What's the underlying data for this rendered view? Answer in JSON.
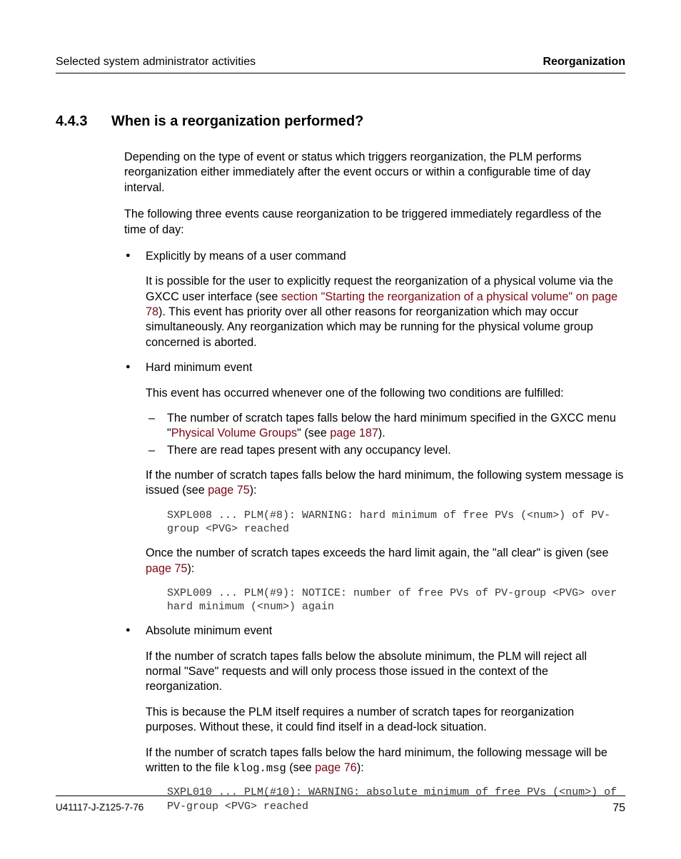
{
  "header": {
    "left": "Selected system administrator activities",
    "right": "Reorganization"
  },
  "section": {
    "number": "4.4.3",
    "title": "When is a reorganization performed?"
  },
  "intro": {
    "p1": "Depending on the type of event or status which triggers reorganization, the PLM performs reorganization either immediately after the event occurs or within a configurable time of day interval.",
    "p2": "The following three events cause reorganization to be triggered immediately regardless of the time of day:"
  },
  "b1": {
    "title": "Explicitly by means of a user command",
    "body_pre": "It is possible for the user to explicitly request the reorganization of a physical volume via the GXCC user interface (see ",
    "link": "section \"Starting the reorganization of a physical volume\" on page 78",
    "body_post": "). This event has priority over all other reasons for reorganization which may occur simultaneously. Any reorganization which may be running for the physical volume group concerned is aborted."
  },
  "b2": {
    "title": "Hard minimum event",
    "lead": "This event has occurred whenever one of the following two conditions are fulfilled:",
    "d1_pre": "The number of scratch tapes falls below the hard minimum specified in the GXCC menu \"",
    "d1_link": "Physical Volume Groups",
    "d1_mid": "\" (see ",
    "d1_page": "page 187",
    "d1_post": ").",
    "d2": "There are read tapes present with any occupancy level.",
    "p1_pre": "If the number of scratch tapes falls below the hard minimum, the following system message is issued (see ",
    "p1_page": "page 75",
    "p1_post": "):",
    "code1": "SXPL008 ... PLM(#8): WARNING: hard minimum of free PVs (<num>) of PV-group <PVG> reached",
    "p2_pre": "Once the number of scratch tapes exceeds the hard limit again, the \"all clear\" is given (see ",
    "p2_page": "page 75",
    "p2_post": "):",
    "code2": "SXPL009 ... PLM(#9): NOTICE: number of free PVs of PV-group <PVG> over hard minimum (<num>) again"
  },
  "b3": {
    "title": "Absolute minimum event",
    "p1": "If the number of scratch tapes falls below the absolute minimum, the PLM will reject all normal \"Save\" requests and will only process those issued in the context of the reorganization.",
    "p2": "This is because the PLM itself requires a number of scratch tapes for reorganization purposes. Without these, it could find itself in a dead-lock situation.",
    "p3_pre": "If the number of scratch tapes falls below the hard minimum, the following message will be written to the file ",
    "p3_file": "klog.msg",
    "p3_mid": " (see ",
    "p3_page": "page 76",
    "p3_post": "):",
    "code": "SXPL010 ... PLM(#10): WARNING: absolute minimum of free PVs (<num>) of PV-group <PVG> reached"
  },
  "footer": {
    "doc_id": "U41117-J-Z125-7-76",
    "page": "75"
  }
}
